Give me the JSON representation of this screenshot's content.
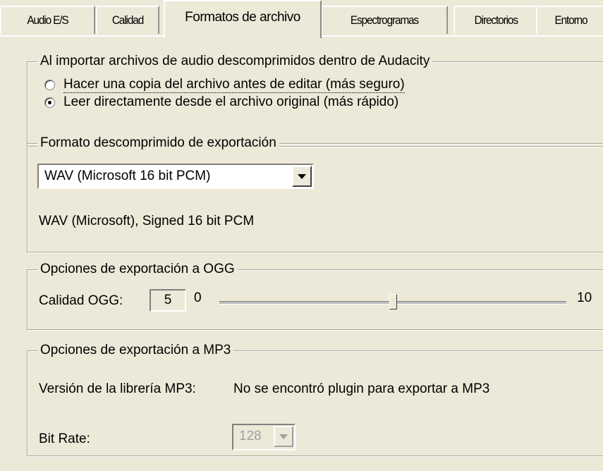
{
  "tabs": [
    {
      "label": "Audio E/S",
      "active": false
    },
    {
      "label": "Calidad",
      "active": false
    },
    {
      "label": "Formatos de archivo",
      "active": true
    },
    {
      "label": "Espectrogramas",
      "active": false
    },
    {
      "label": "Directorios",
      "active": false
    },
    {
      "label": "Entorno",
      "active": false
    }
  ],
  "import_group": {
    "title": "Al importar archivos de audio descomprimidos dentro de Audacity",
    "option_copy": "Hacer una copia del archivo antes de editar (más seguro)",
    "option_direct": "Leer directamente desde el archivo original (más rápido)",
    "selected": "option_direct"
  },
  "export_format_group": {
    "title": "Formato descomprimido de exportación",
    "selected_format": "WAV (Microsoft 16 bit PCM)",
    "format_description": "WAV (Microsoft), Signed 16 bit PCM"
  },
  "ogg_group": {
    "title": "Opciones de exportación a OGG",
    "quality_label": "Calidad OGG:",
    "quality_value": "5",
    "min_label": "0",
    "max_label": "10",
    "slider_fraction": 0.5
  },
  "mp3_group": {
    "title": "Opciones de exportación a MP3",
    "version_label": "Versión de la librería MP3:",
    "version_value": "No se encontró plugin para exportar a MP3",
    "bitrate_label": "Bit Rate:",
    "bitrate_value": "128",
    "bitrate_enabled": false
  }
}
